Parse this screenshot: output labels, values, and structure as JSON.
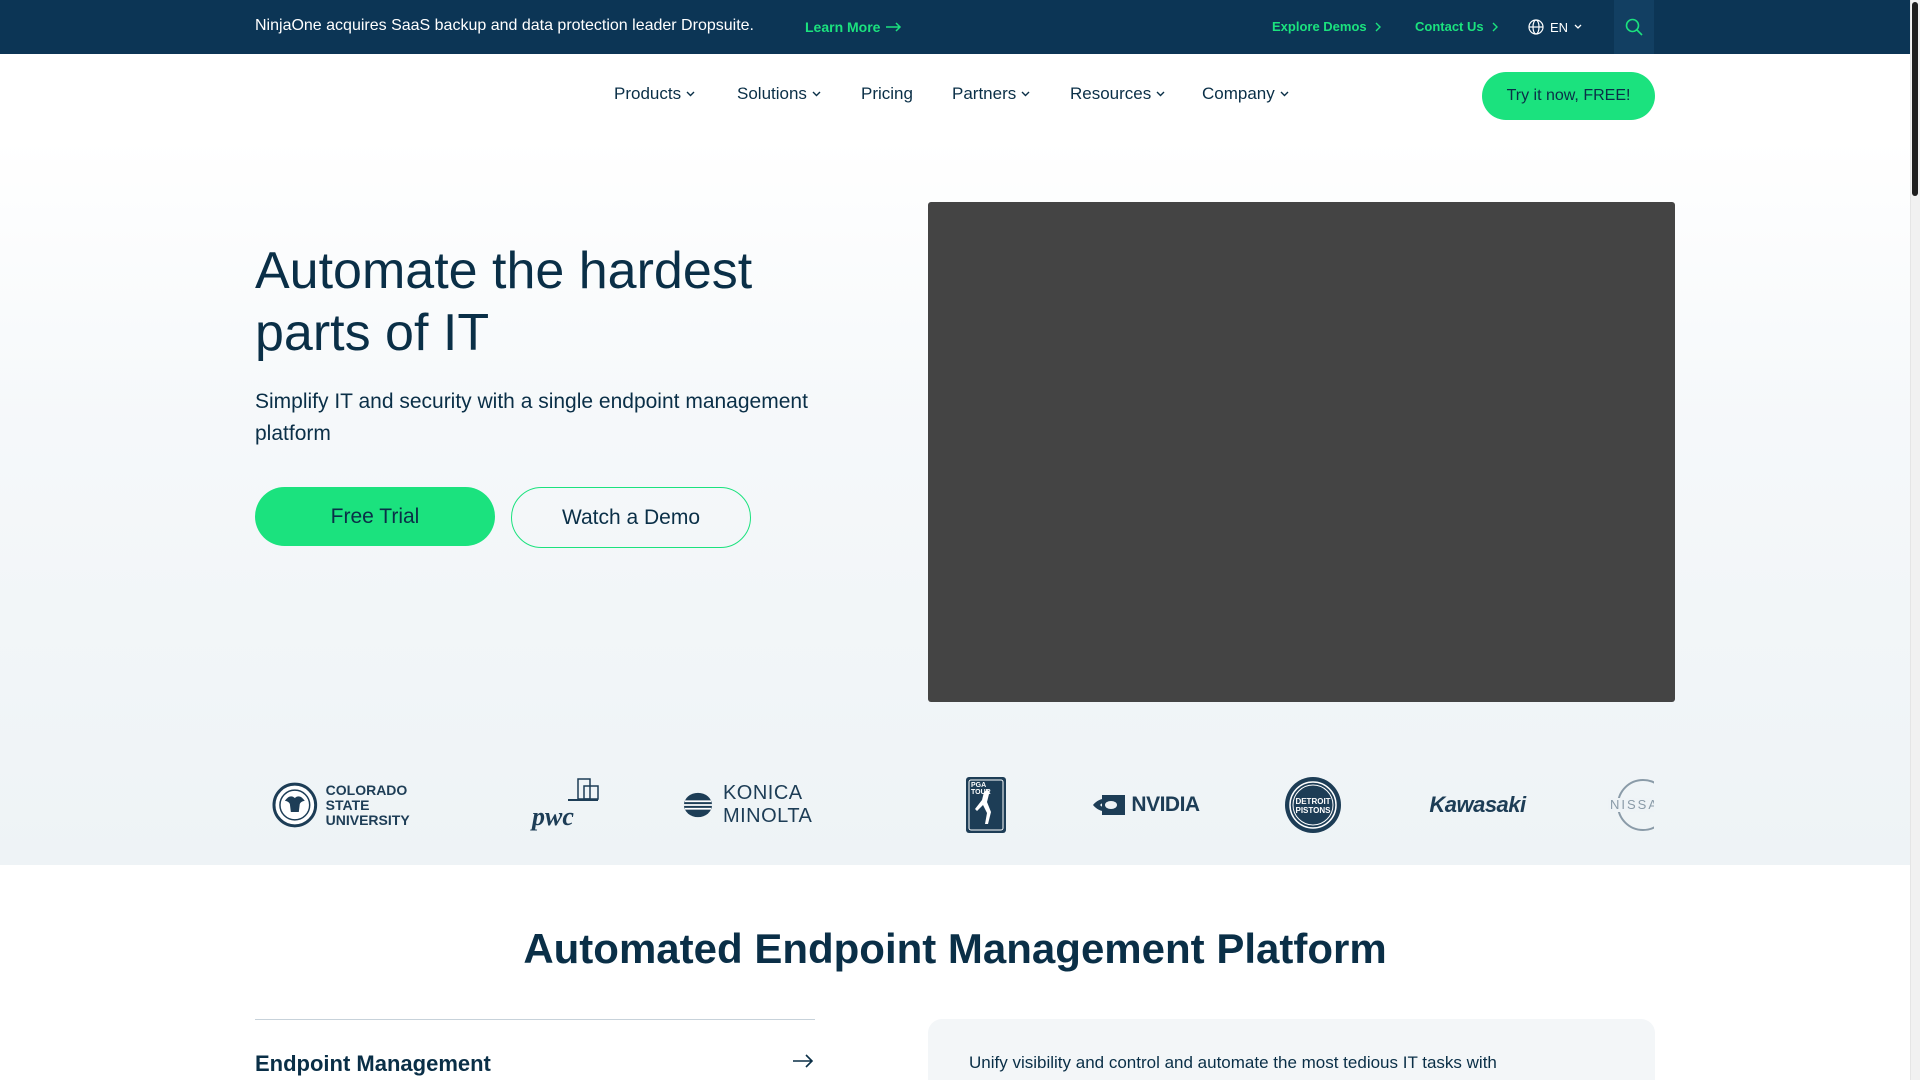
{
  "announcement": {
    "text": "NinjaOne acquires SaaS backup and data protection leader Dropsuite.",
    "link": "Learn More"
  },
  "utility": {
    "explore_demos": "Explore Demos",
    "contact_us": "Contact Us",
    "language": "EN"
  },
  "nav": {
    "items": [
      "Products",
      "Solutions",
      "Pricing",
      "Partners",
      "Resources",
      "Company"
    ],
    "cta": "Try it now, FREE!"
  },
  "hero": {
    "title": "Automate the hardest parts of IT",
    "subtitle": "Simplify IT and security with a single endpoint management platform",
    "primary_button": "Free Trial",
    "secondary_button": "Watch a Demo"
  },
  "logos": {
    "colorado_line1": "COLORADO STATE",
    "colorado_line2": "UNIVERSITY",
    "pwc": "pwc",
    "konica": "KONICA MINOLTA",
    "pga": "PGA TOUR",
    "nvidia": "NVIDIA",
    "pistons": "DETROIT PISTONS",
    "kawasaki": "Kawasaki",
    "nissan": "NISSAN"
  },
  "section": {
    "title": "Automated Endpoint Management Platform",
    "accordion_first": "Endpoint Management",
    "panel_text": "Unify visibility and control and automate the most tedious IT tasks with"
  },
  "colors": {
    "brand_navy": "#0c3555",
    "accent_green": "#1be27e",
    "video_gray": "#444444"
  },
  "icons": [
    "arrow-right-icon",
    "chevron-right-icon",
    "globe-icon",
    "chevron-down-icon",
    "search-icon"
  ]
}
